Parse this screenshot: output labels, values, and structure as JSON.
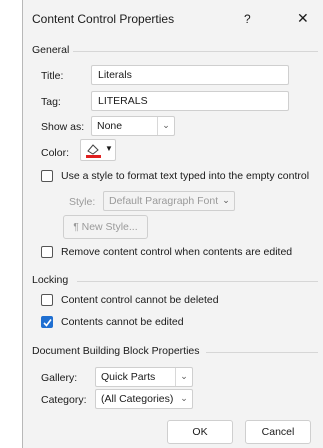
{
  "dialog": {
    "title": "Content Control Properties",
    "help_glyph": "?",
    "close_glyph": "✕"
  },
  "general": {
    "heading": "General",
    "title_label": "Title:",
    "title_value": "Literals",
    "tag_label": "Tag:",
    "tag_value": "LITERALS",
    "show_as_label": "Show as:",
    "show_as_value": "None",
    "color_label": "Color:",
    "color_swatch": "#e02020",
    "use_style_label": "Use a style to format text typed into the empty control",
    "use_style_checked": false,
    "style_label": "Style:",
    "style_value": "Default Paragraph Font",
    "new_style_label": "New Style...",
    "remove_label": "Remove content control when contents are edited",
    "remove_checked": false
  },
  "locking": {
    "heading": "Locking",
    "cannot_delete_label": "Content control cannot be deleted",
    "cannot_delete_checked": false,
    "cannot_edit_label": "Contents cannot be edited",
    "cannot_edit_checked": true
  },
  "building_block": {
    "heading": "Document Building Block Properties",
    "gallery_label": "Gallery:",
    "gallery_value": "Quick Parts",
    "category_label": "Category:",
    "category_value": "(All Categories)"
  },
  "buttons": {
    "ok": "OK",
    "cancel": "Cancel"
  }
}
